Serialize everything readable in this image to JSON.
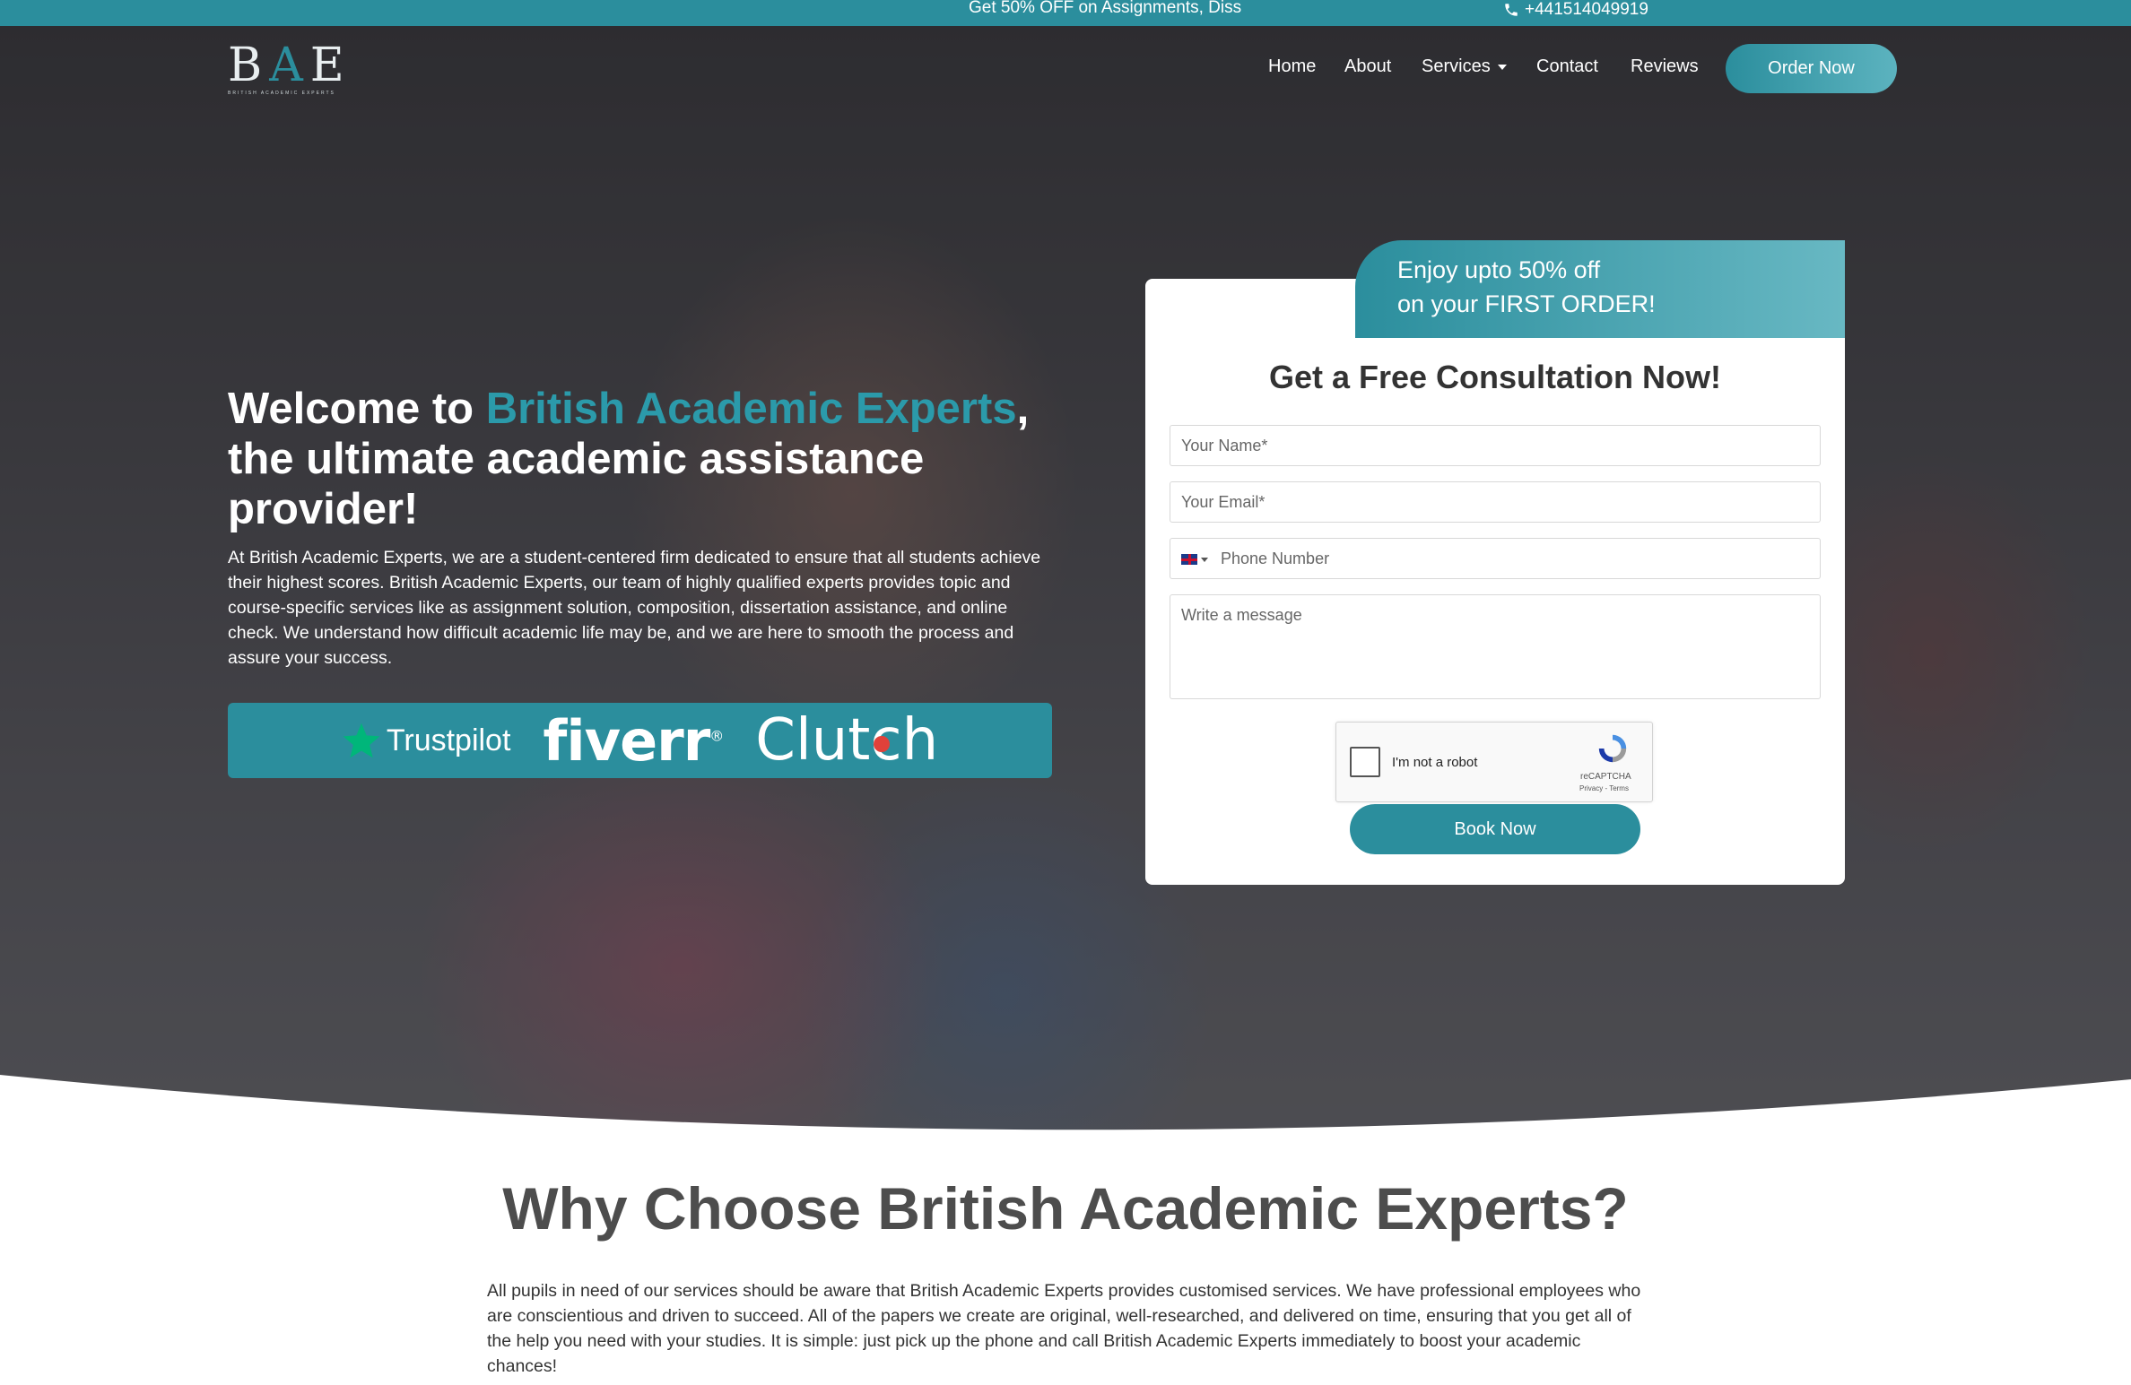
{
  "topbar": {
    "promo": "Get 50% OFF on Assignments, Diss",
    "phone": "+441514049919",
    "phone_icon": "phone-icon"
  },
  "logo": {
    "letters": [
      "B",
      "A",
      "E"
    ],
    "tagline": "BRITISH ACADEMIC EXPERTS"
  },
  "nav": {
    "items": [
      "Home",
      "About",
      "Services",
      "Contact",
      "Reviews"
    ],
    "order_button": "Order Now"
  },
  "hero": {
    "title_prefix": "Welcome to ",
    "title_brand": "British Academic Experts",
    "title_suffix": ", the ultimate academic assistance provider!",
    "description": "At British Academic Experts, we are a student-centered firm dedicated to ensure that all students achieve their highest scores. British Academic Experts, our team of highly qualified experts provides topic and course-specific services like as assignment solution, composition, dissertation assistance, and online check. We understand how difficult academic life may be, and we are here to smooth the process and assure your success.",
    "badges": {
      "trustpilot": "Trustpilot",
      "fiverr": "fiverr",
      "fiverr_mark": "®",
      "clutch": "Clutch"
    }
  },
  "form": {
    "ribbon_line1": "Enjoy upto 50% off",
    "ribbon_line2": "on your FIRST ORDER!",
    "title_main": "Get a Free Consultation ",
    "title_bold": "Now!",
    "name_placeholder": "Your Name*",
    "email_placeholder": "Your Email*",
    "phone_placeholder": "Phone Number",
    "message_placeholder": "Write a message",
    "captcha_label": "I'm not a robot",
    "captcha_brand": "reCAPTCHA",
    "captcha_links": "Privacy - Terms",
    "submit": "Book Now"
  },
  "why": {
    "title": "Why Choose British Academic Experts?",
    "text": "All pupils in need of our services should be aware that British Academic Experts provides customised services. We have professional employees who are conscientious and driven to succeed. All of the papers we create are original, well-researched, and delivered on time, ensuring that you get all of the help you need with your studies. It is simple: just pick up the phone and call British Academic Experts immediately to boost your academic chances!"
  },
  "colors": {
    "accent": "#2b8e9d",
    "topbar": "#2b8e9d",
    "heading_gray": "#4d4d4d"
  }
}
